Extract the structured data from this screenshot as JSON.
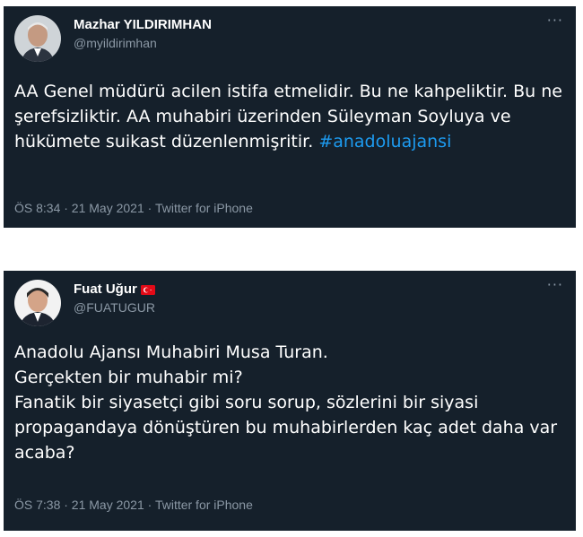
{
  "tweets": [
    {
      "name": "Mazhar YILDIRIMHAN",
      "handle": "@myildirimhan",
      "text_plain": "AA Genel müdürü acilen istifa etmelidir. Bu ne kahpeliktir. Bu ne şerefsizliktir. AA muhabiri üzerinden Süleyman Soyluya ve hükümete suikast düzenlenmişritir. ",
      "hashtag": "#anadoluajansi",
      "meta": "ÖS 8:34 · 21 May 2021 · Twitter for iPhone",
      "more_icon": "more-horizontal-icon"
    },
    {
      "name": "Fuat Uğur",
      "handle": "@FUATUGUR",
      "text_plain": "Anadolu Ajansı Muhabiri Musa Turan.\nGerçekten bir muhabir mi?\nFanatik bir siyasetçi gibi soru sorup, sözlerini bir siyasi propagandaya dönüştüren bu muhabirlerden kaç adet daha var acaba?",
      "meta": "ÖS 7:38 · 21 May 2021 · Twitter for iPhone",
      "flag_icon": "turkey-flag-icon",
      "more_icon": "more-horizontal-icon"
    }
  ],
  "colors": {
    "background": "#15202b",
    "text": "#ffffff",
    "muted": "#8b98a5",
    "hashtag": "#1d9bf0"
  }
}
